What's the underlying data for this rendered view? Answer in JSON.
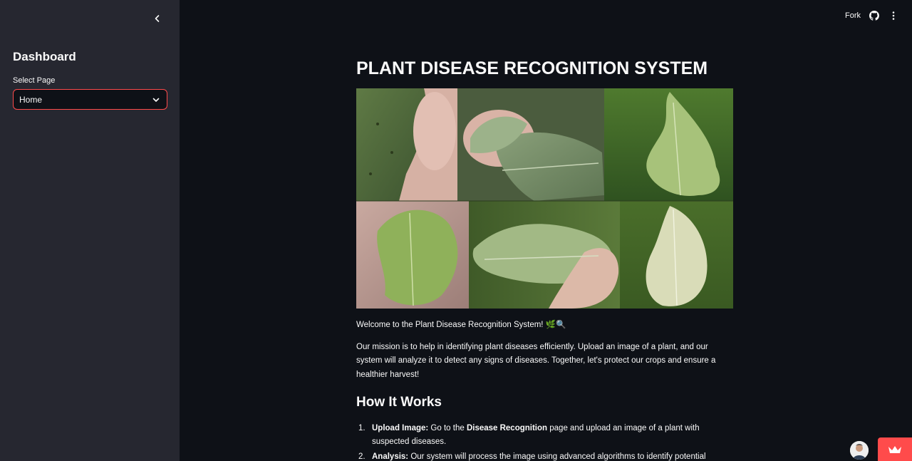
{
  "sidebar": {
    "title": "Dashboard",
    "select_label": "Select Page",
    "select_value": "Home"
  },
  "header": {
    "fork_label": "Fork",
    "icons": [
      "github-icon",
      "more-vertical-icon"
    ]
  },
  "main": {
    "title": "PLANT DISEASE RECOGNITION SYSTEM",
    "welcome": "Welcome to the Plant Disease Recognition System! 🌿🔍",
    "mission": "Our mission is to help in identifying plant diseases efficiently. Upload an image of a plant, and our system will analyze it to detect any signs of diseases. Together, let's protect our crops and ensure a healthier harvest!",
    "how_title": "How It Works",
    "steps": [
      {
        "num": "1.",
        "label": "Upload Image:",
        "pre": " Go to the ",
        "bold": "Disease Recognition",
        "post": " page and upload an image of a plant with suspected diseases."
      },
      {
        "num": "2.",
        "label": "Analysis:",
        "text": " Our system will process the image using advanced algorithms to identify potential diseases."
      }
    ]
  },
  "colors": {
    "background": "#0e1117",
    "sidebar": "#262730",
    "accent": "#ff4b4b"
  }
}
